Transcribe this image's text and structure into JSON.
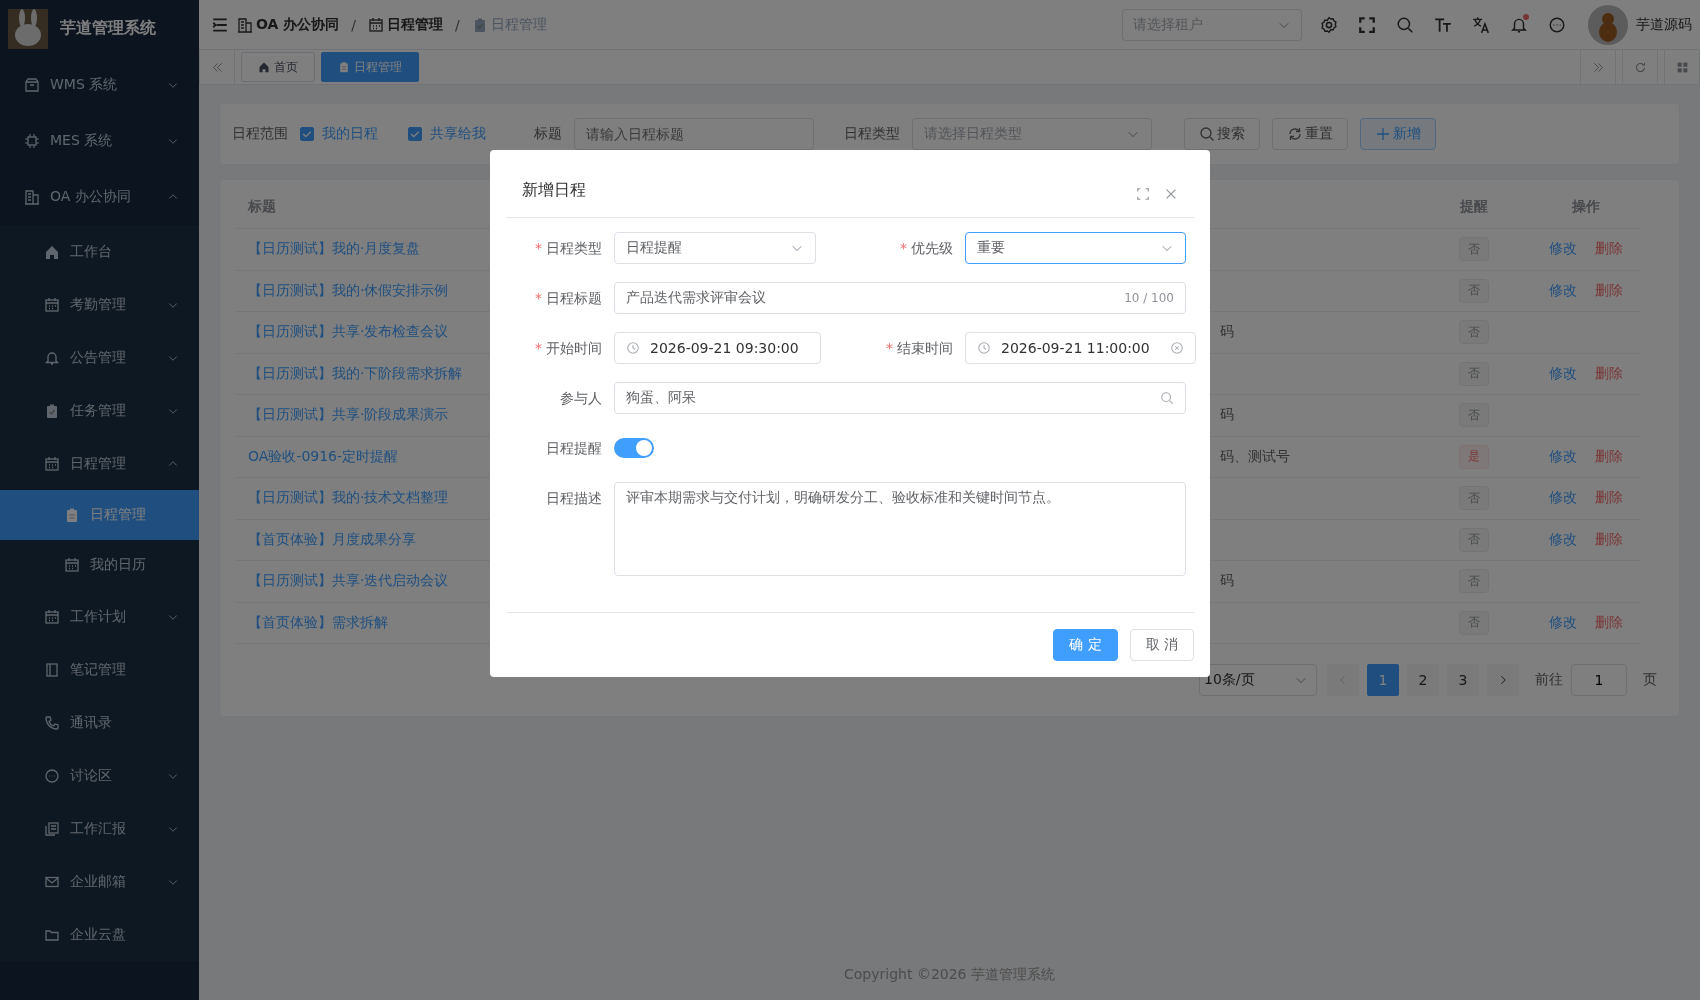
{
  "sidebar": {
    "logo_title": "芋道管理系统",
    "items": [
      {
        "label": "WMS 系统",
        "expanded": false
      },
      {
        "label": "MES 系统",
        "expanded": false
      },
      {
        "label": "OA 办公协同",
        "expanded": true,
        "children": [
          {
            "label": "工作台"
          },
          {
            "label": "考勤管理",
            "expanded": false
          },
          {
            "label": "公告管理",
            "expanded": false
          },
          {
            "label": "任务管理",
            "expanded": false
          },
          {
            "label": "日程管理",
            "expanded": true,
            "children": [
              {
                "label": "日程管理",
                "selected": true
              },
              {
                "label": "我的日历",
                "selected": false
              }
            ]
          },
          {
            "label": "工作计划",
            "expanded": false
          },
          {
            "label": "笔记管理"
          },
          {
            "label": "通讯录"
          },
          {
            "label": "讨论区",
            "expanded": false
          },
          {
            "label": "工作汇报",
            "expanded": false
          },
          {
            "label": "企业邮箱",
            "expanded": false
          },
          {
            "label": "企业云盘"
          }
        ]
      }
    ]
  },
  "header": {
    "breadcrumbs": [
      {
        "label": "OA 办公协同"
      },
      {
        "separator": "/",
        "label": "日程管理"
      },
      {
        "separator": "/",
        "label": "日程管理"
      }
    ],
    "tenant_select": {
      "placeholder": "请选择租户"
    },
    "user": {
      "name": "芋道源码"
    }
  },
  "tabs": [
    {
      "label": "首页",
      "selected": false
    },
    {
      "label": "日程管理",
      "selected": true
    }
  ],
  "filter": {
    "scope": {
      "label": "日程范围",
      "options": [
        {
          "label": "我的日程",
          "checked": true
        },
        {
          "label": "共享给我",
          "checked": true
        }
      ]
    },
    "title_field": {
      "label": "标题",
      "placeholder": "请输入日程标题"
    },
    "type_field": {
      "label": "日程类型",
      "placeholder": "请选择日程类型"
    },
    "buttons": [
      {
        "label": "搜索",
        "kind": "search"
      },
      {
        "label": "重置",
        "kind": "reset"
      },
      {
        "label": "新增",
        "kind": "add"
      }
    ]
  },
  "table": {
    "columns": [
      "标题",
      "提醒",
      "操作"
    ],
    "rows": [
      {
        "title": "【日历测试】我的·月度复盘",
        "reminder": {
          "label": "否",
          "on": false
        },
        "actions": [
          {
            "label": "修改",
            "kind": "edit"
          },
          {
            "label": "删除",
            "kind": "delete"
          }
        ]
      },
      {
        "title": "【日历测试】我的·休假安排示例",
        "reminder": {
          "label": "否",
          "on": false
        },
        "actions": [
          {
            "label": "修改",
            "kind": "edit"
          },
          {
            "label": "删除",
            "kind": "delete"
          }
        ]
      },
      {
        "title": "【日历测试】共享·发布检查会议",
        "column_2": "码",
        "reminder": {
          "label": "否",
          "on": false
        },
        "actions": []
      },
      {
        "title": "【日历测试】我的·下阶段需求拆解",
        "reminder": {
          "label": "否",
          "on": false
        },
        "actions": [
          {
            "label": "修改",
            "kind": "edit"
          },
          {
            "label": "删除",
            "kind": "delete"
          }
        ]
      },
      {
        "title": "【日历测试】共享·阶段成果演示",
        "column_2": "码",
        "reminder": {
          "label": "否",
          "on": false
        },
        "actions": []
      },
      {
        "title": "OA验收-0916-定时提醒",
        "column_2": "码、测试号",
        "reminder": {
          "label": "是",
          "on": true
        },
        "actions": [
          {
            "label": "修改",
            "kind": "edit"
          },
          {
            "label": "删除",
            "kind": "delete"
          }
        ]
      },
      {
        "title": "【日历测试】我的·技术文档整理",
        "reminder": {
          "label": "否",
          "on": false
        },
        "actions": [
          {
            "label": "修改",
            "kind": "edit"
          },
          {
            "label": "删除",
            "kind": "delete"
          }
        ]
      },
      {
        "title": "【首页体验】月度成果分享",
        "reminder": {
          "label": "否",
          "on": false
        },
        "actions": [
          {
            "label": "修改",
            "kind": "edit"
          },
          {
            "label": "删除",
            "kind": "delete"
          }
        ]
      },
      {
        "title": "【日历测试】共享·迭代启动会议",
        "column_2": "码",
        "reminder": {
          "label": "否",
          "on": false
        },
        "actions": []
      },
      {
        "title": "【首页体验】需求拆解",
        "reminder": {
          "label": "否",
          "on": false
        },
        "actions": [
          {
            "label": "修改",
            "kind": "edit"
          },
          {
            "label": "删除",
            "kind": "delete"
          }
        ]
      }
    ]
  },
  "pagination": {
    "page_size": "10条/页",
    "pages": [
      {
        "label": "1",
        "selected": true
      },
      {
        "label": "2",
        "selected": false
      },
      {
        "label": "3",
        "selected": false
      }
    ],
    "goto_label": "前往",
    "goto_value": "1",
    "goto_suffix": "页"
  },
  "dialog": {
    "title": "新增日程",
    "rows": [
      {
        "fields": [
          {
            "label": "日程类型",
            "required_mark": "*",
            "kind": "select",
            "value": "日程提醒",
            "focused": false
          },
          {
            "label": "优先级",
            "required_mark": "*",
            "kind": "select",
            "value": "重要",
            "focused": true
          }
        ]
      },
      {
        "fields": [
          {
            "label": "日程标题",
            "required_mark": "*",
            "kind": "text",
            "value": "产品迭代需求评审会议",
            "counter": "10 / 100"
          }
        ]
      },
      {
        "fields": [
          {
            "label": "开始时间",
            "required_mark": "*",
            "kind": "datetime",
            "value": "2026-09-21 09:30:00",
            "clearable": false
          },
          {
            "label": "结束时间",
            "required_mark": "*",
            "kind": "datetime",
            "value": "2026-09-21 11:00:00",
            "clearable": true
          }
        ]
      },
      {
        "fields": [
          {
            "label": "参与人",
            "kind": "search",
            "value": "狗蛋、阿呆"
          }
        ]
      },
      {
        "fields": [
          {
            "label": "日程提醒",
            "kind": "switch",
            "on": true
          }
        ]
      },
      {
        "fields": [
          {
            "label": "日程描述",
            "kind": "textarea",
            "value": "评审本期需求与交付计划，明确研发分工、验收标准和关键时间节点。"
          }
        ]
      }
    ],
    "buttons": [
      {
        "label": "确 定",
        "kind": "primary"
      },
      {
        "label": "取 消",
        "kind": "default"
      }
    ]
  },
  "footer": {
    "copyright": "Copyright ©2026 芋道管理系统"
  }
}
